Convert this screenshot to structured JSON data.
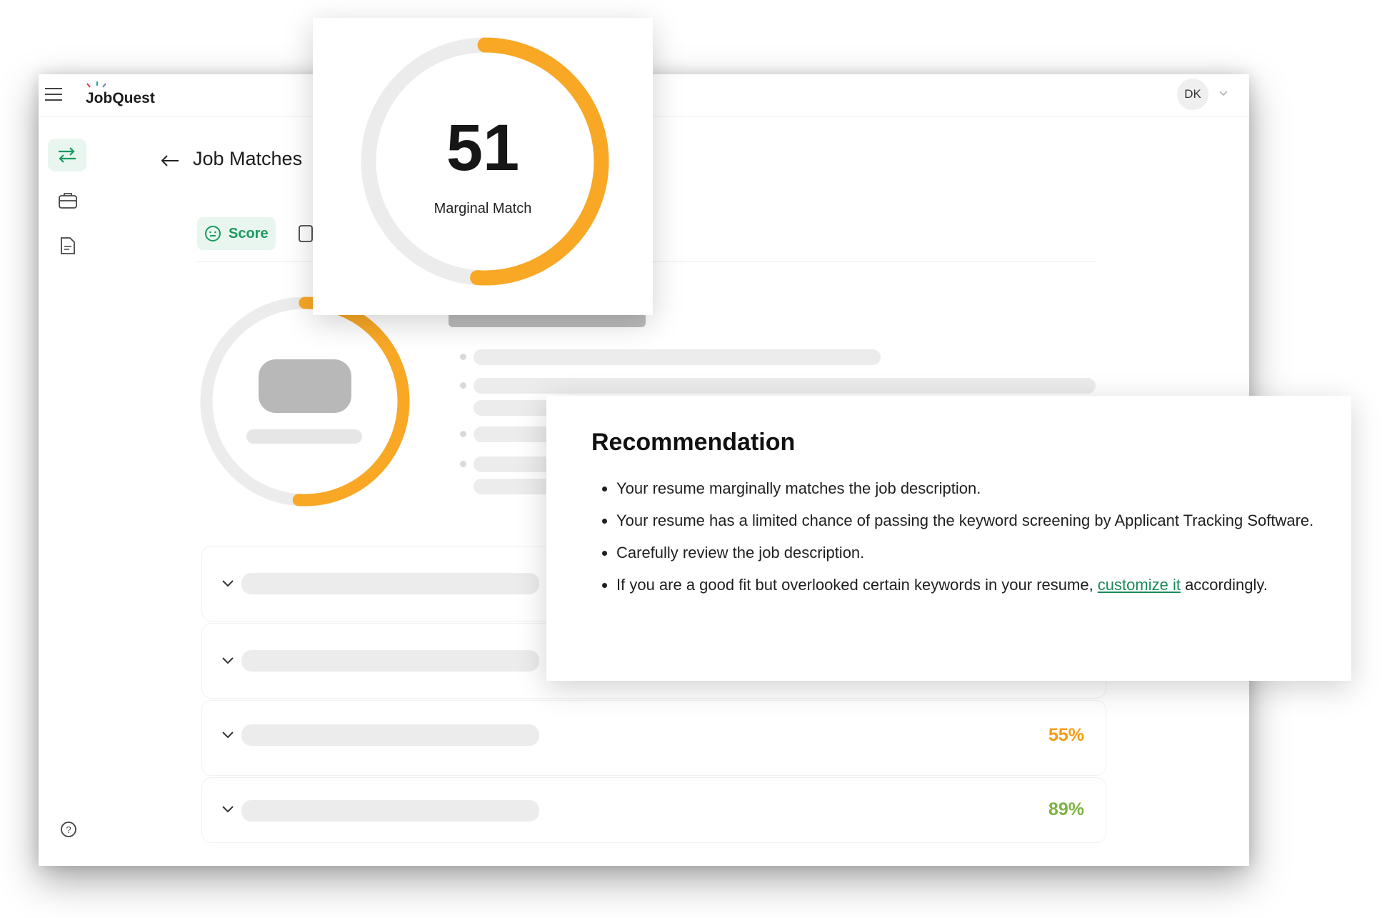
{
  "app": {
    "brand": "JobQuest",
    "user_initials": "DK"
  },
  "page": {
    "title": "Job Matches"
  },
  "tabs": [
    {
      "label": "Score",
      "icon": "smiley-icon",
      "active": true
    }
  ],
  "score": {
    "value": 51,
    "max": 100,
    "label": "Marginal Match",
    "color": "#f9a825"
  },
  "sections": [
    {
      "percent": "55%",
      "color": "#f39c12"
    },
    {
      "percent": "89%",
      "color": "#7cb342"
    }
  ],
  "recommendation": {
    "title": "Recommendation",
    "items": [
      "Your resume marginally matches the job description.",
      "Your resume has a limited chance of passing the keyword screening by Applicant Tracking Software.",
      "Carefully review the job description."
    ],
    "last_item_before": "If you are a good fit but overlooked certain keywords in your resume, ",
    "last_item_link": "customize it",
    "last_item_after": " accordingly."
  },
  "colors": {
    "accent": "#1a9a5f",
    "accent_bg": "#e8f6ef",
    "gauge": "#f9a825",
    "track": "#ececec"
  }
}
